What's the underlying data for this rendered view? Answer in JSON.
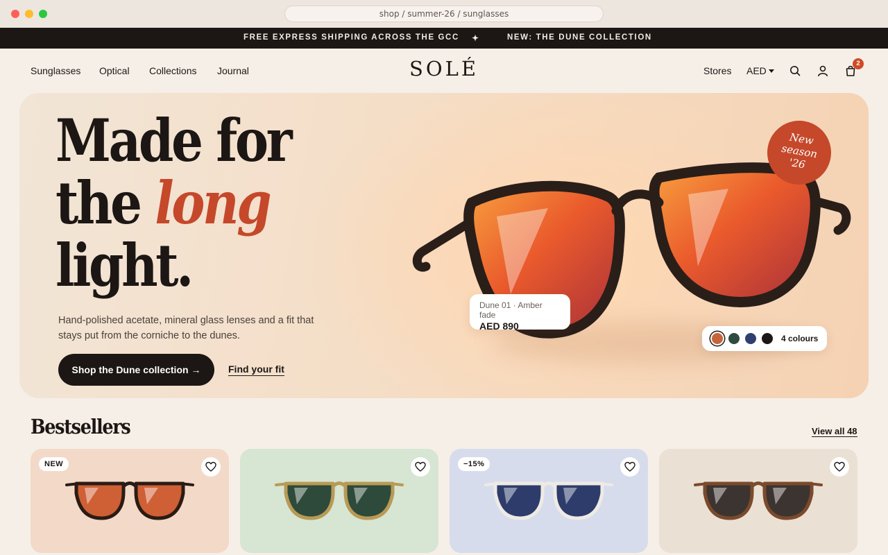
{
  "browser": {
    "url": "shop / summer-26 / sunglasses"
  },
  "announcement": {
    "left": "FREE EXPRESS SHIPPING ACROSS THE GCC",
    "separator": "✦",
    "right": "NEW: THE DUNE COLLECTION"
  },
  "nav": {
    "links": [
      "Sunglasses",
      "Optical",
      "Collections",
      "Journal"
    ],
    "logo": "SOLÉ",
    "stores": "Stores",
    "currency": "AED",
    "cart_count": "2",
    "icons": [
      "search-icon",
      "account-icon",
      "cart-icon",
      "chevron-down-icon"
    ]
  },
  "hero": {
    "headline_line1": "Made for",
    "headline_line2_plain": "the",
    "headline_line2_accent": "long",
    "headline_line3": "light.",
    "subtitle": "Hand-polished acetate, mineral glass lenses and a fit that stays put from the corniche to the dunes.",
    "cta_primary": "Shop the Dune collection →",
    "cta_secondary": "Find your fit",
    "badge_line1": "New",
    "badge_line2": "season",
    "badge_line3": "'26",
    "product_name": "Dune 01 · Amber fade",
    "product_price": "AED 890",
    "swatch_label": "4 colours",
    "swatch_colors": [
      "#c8643a",
      "#2e4a3e",
      "#2f3f6e",
      "#1c1714"
    ],
    "accent_color": "#c5482a"
  },
  "bestsellers": {
    "title": "Bestsellers",
    "view_all": "View all 48",
    "cards": [
      {
        "tag": "NEW",
        "bg": "#f3d9c8",
        "frame": "#2a1c14",
        "lens": "#cf5f35"
      },
      {
        "tag": "",
        "bg": "#d7e5d3",
        "frame": "#b89a55",
        "lens": "#2e4a3a"
      },
      {
        "tag": "−15%",
        "bg": "#d7dcec",
        "frame": "#eeeae4",
        "lens": "#2d3c6a"
      },
      {
        "tag": "",
        "bg": "#ebe0d4",
        "frame": "#7a4a2c",
        "lens": "#3c3431"
      }
    ]
  }
}
